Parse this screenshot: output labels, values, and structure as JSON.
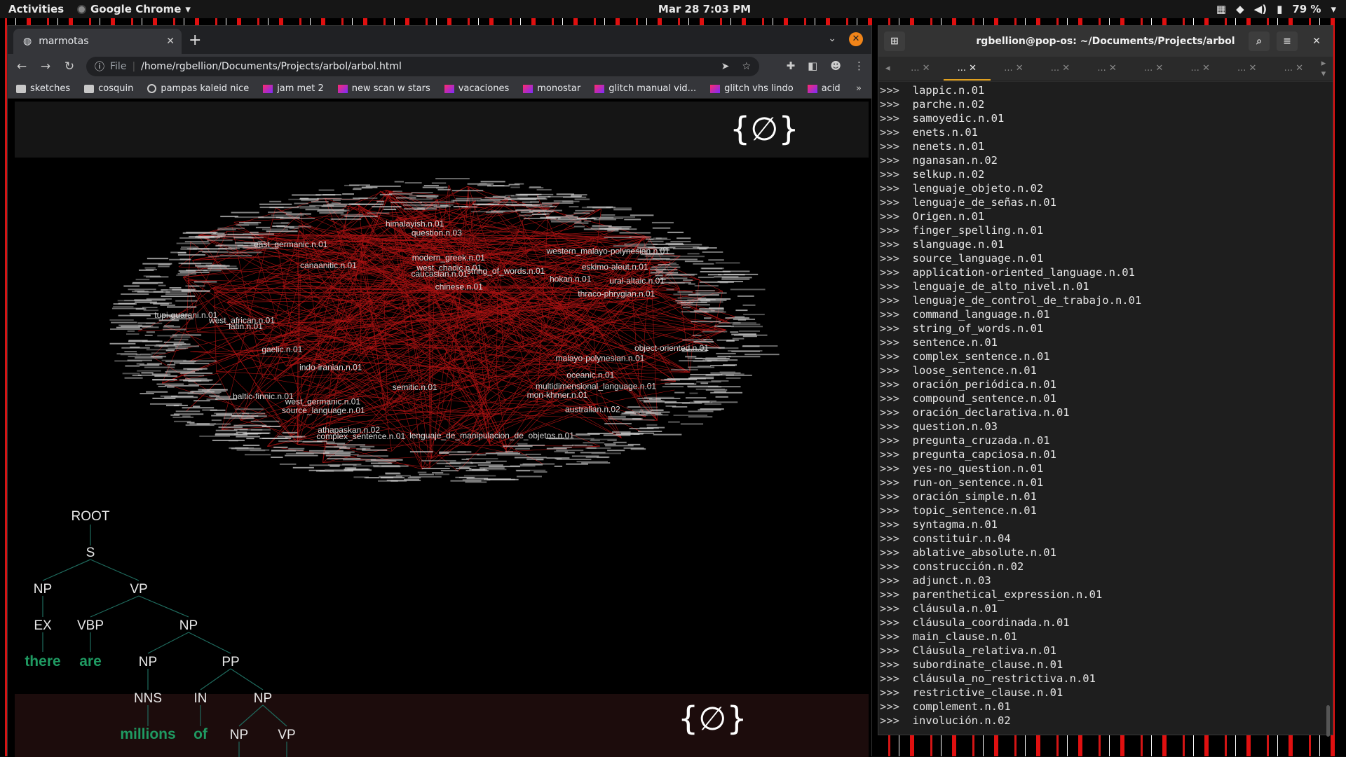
{
  "topbar": {
    "activities": "Activities",
    "app_name": "Google Chrome",
    "clock": "Mar 28  7:03 PM",
    "battery": "79 %"
  },
  "chrome": {
    "tab_title": "marmotas",
    "url_label": "File",
    "url": "/home/rgbellion/Documents/Projects/arbol/arbol.html",
    "bookmarks": [
      {
        "label": "sketches",
        "icon": "folder-icon"
      },
      {
        "label": "cosquin",
        "icon": "folder-icon"
      },
      {
        "label": "pampas kaleid nice",
        "icon": "globe-icon"
      },
      {
        "label": "jam met 2",
        "icon": "image-icon"
      },
      {
        "label": "new scan w stars",
        "icon": "image-icon"
      },
      {
        "label": "vacaciones",
        "icon": "image-icon"
      },
      {
        "label": "monostar",
        "icon": "image-icon"
      },
      {
        "label": "glitch manual vid...",
        "icon": "image-icon"
      },
      {
        "label": "glitch vhs lindo",
        "icon": "image-icon"
      },
      {
        "label": "acid",
        "icon": "image-icon"
      }
    ]
  },
  "page": {
    "emptyset_symbol": "{∅}",
    "graph_labels": [
      "east_germanic.n.01",
      "latin.n.01",
      "baltic-finnic.n.01",
      "string_of_words.n.01",
      "australian.n.02",
      "west_african.n.01",
      "hokan.n.01",
      "mon-khmer.n.01",
      "caucasian.n.01",
      "athapaskan.n.02",
      "west_germanic.n.01",
      "indo-iranian.n.01",
      "thraco-phrygian.n.01",
      "source_language.n.01",
      "malayo-polynesian.n.01",
      "west_chadic.n.01",
      "western_malayo-polynesian.n.01",
      "modern_greek.n.01",
      "tupi-guarani.n.01",
      "question.n.03",
      "object-oriented.n.01",
      "eskimo-aleut.n.01",
      "chinese.n.01",
      "gaelic.n.01",
      "ural-altaic.n.01",
      "canaanitic.n.01",
      "himalayish.n.01",
      "multidimensional_language.n.01",
      "semitic.n.01",
      "oceanic.n.01",
      "complex_sentence.n.01",
      "lenguaje_de_manipulacion_de_objetos.n.01"
    ],
    "tree": {
      "root": "ROOT",
      "s": "S",
      "np1": "NP",
      "vp1": "VP",
      "ex": "EX",
      "vbp": "VBP",
      "np2": "NP",
      "w_there": "there",
      "w_are": "are",
      "np3": "NP",
      "pp": "PP",
      "nns": "NNS",
      "in": "IN",
      "np4": "NP",
      "w_millions": "millions",
      "w_of": "of",
      "np5": "NP",
      "vp2": "VP"
    }
  },
  "terminal": {
    "title": "rgbellion@pop-os: ~/Documents/Projects/arbol",
    "tabs": [
      "...",
      "...",
      "...",
      "...",
      "...",
      "...",
      "...",
      "...",
      "..."
    ],
    "active_tab": 1,
    "prompt": ">>>",
    "lines": [
      "lappic.n.01",
      "parche.n.02",
      "samoyedic.n.01",
      "enets.n.01",
      "nenets.n.01",
      "nganasan.n.02",
      "selkup.n.02",
      "lenguaje_objeto.n.02",
      "lenguaje_de_señas.n.01",
      "Origen.n.01",
      "finger_spelling.n.01",
      "slanguage.n.01",
      "source_language.n.01",
      "application-oriented_language.n.01",
      "lenguaje_de_alto_nivel.n.01",
      "lenguaje_de_control_de_trabajo.n.01",
      "command_language.n.01",
      "string_of_words.n.01",
      "sentence.n.01",
      "complex_sentence.n.01",
      "loose_sentence.n.01",
      "oración_periódica.n.01",
      "compound_sentence.n.01",
      "oración_declarativa.n.01",
      "question.n.03",
      "pregunta_cruzada.n.01",
      "pregunta_capciosa.n.01",
      "yes-no_question.n.01",
      "run-on_sentence.n.01",
      "oración_simple.n.01",
      "topic_sentence.n.01",
      "syntagma.n.01",
      "constituir.n.04",
      "ablative_absolute.n.01",
      "construcción.n.02",
      "adjunct.n.03",
      "parenthetical_expression.n.01",
      "cláusula.n.01",
      "cláusula_coordinada.n.01",
      "main_clause.n.01",
      "Cláusula_relativa.n.01",
      "subordinate_clause.n.01",
      "cláusula_no_restrictiva.n.01",
      "restrictive_clause.n.01",
      "complement.n.01",
      "involución.n.02"
    ]
  }
}
